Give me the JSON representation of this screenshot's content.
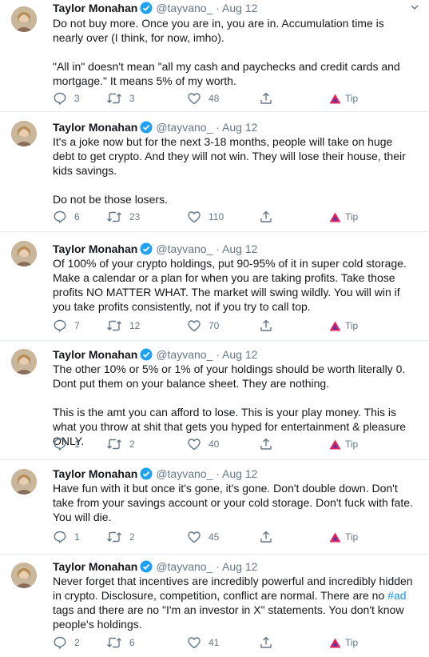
{
  "tweets": [
    {
      "name": "Taylor Monahan",
      "handle": "@tayvano_",
      "separator": "·",
      "date": "Aug 12",
      "paragraphs": [
        "Do not buy more. Once you are in, you are in. Accumulation time is nearly over (I think, for now, imho).",
        "\"All in\" doesn't mean \"all my cash and paychecks and credit cards and mortgage.\" It means 5% of my worth."
      ],
      "replies": "3",
      "retweets": "3",
      "likes": "48",
      "tip": "Tip"
    },
    {
      "name": "Taylor Monahan",
      "handle": "@tayvano_",
      "separator": "·",
      "date": "Aug 12",
      "paragraphs": [
        "It's a joke now but for the next 3-18 months, people will take on huge debt to get crypto. And they will not win. They will lose their house, their kids savings.",
        "Do not be those losers."
      ],
      "replies": "6",
      "retweets": "23",
      "likes": "110",
      "tip": "Tip"
    },
    {
      "name": "Taylor Monahan",
      "handle": "@tayvano_",
      "separator": "·",
      "date": "Aug 12",
      "paragraphs": [
        "Of 100% of your crypto holdings, put 90-95% of it in super cold storage. Make a calendar or a plan for when you are taking profits. Take those profits NO MATTER WHAT. The market will swing wildly. You will win if you take profits consistently, not if you try to call top."
      ],
      "replies": "7",
      "retweets": "12",
      "likes": "70",
      "tip": "Tip"
    },
    {
      "name": "Taylor Monahan",
      "handle": "@tayvano_",
      "separator": "·",
      "date": "Aug 12",
      "paragraphs": [
        "The other 10% or 5% or 1% of your holdings should be worth literally 0. Dont put them on your balance sheet. They are nothing.",
        "This is the amt you can afford to lose. This is your play money. This is what you throw at shit that gets you hyped for entertainment & pleasure ONLY."
      ],
      "replies": "1",
      "retweets": "2",
      "likes": "40",
      "tip": "Tip"
    },
    {
      "name": "Taylor Monahan",
      "handle": "@tayvano_",
      "separator": "·",
      "date": "Aug 12",
      "paragraphs": [
        "Have fun with it but once it's gone, it's gone. Don't double down. Don't take from your savings account or your cold storage. Don't fuck with fate. You will die."
      ],
      "replies": "1",
      "retweets": "2",
      "likes": "45",
      "tip": "Tip"
    },
    {
      "name": "Taylor Monahan",
      "handle": "@tayvano_",
      "separator": "·",
      "date": "Aug 12",
      "paragraph_pre": "Never forget that incentives are incredibly powerful and incredibly hidden in crypto. Disclosure, competition, conflict are normal. There are no ",
      "hashtag": "#ad",
      "paragraph_post": " tags and there are no \"I'm an investor in X\" statements. You don't know people's holdings.",
      "replies": "2",
      "retweets": "6",
      "likes": "41",
      "tip": "Tip"
    }
  ],
  "colors": {
    "verified": "#1da1f2",
    "hashtag": "#1b95e0",
    "muted": "#657786",
    "tip": "#e0245e"
  },
  "icons": [
    "avatar-photo",
    "verified-badge-icon",
    "caret-down-icon",
    "reply-icon",
    "retweet-icon",
    "like-icon",
    "share-icon",
    "tip-icon"
  ]
}
